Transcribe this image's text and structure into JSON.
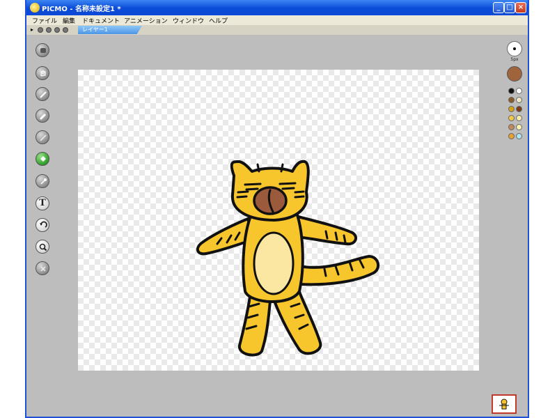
{
  "window": {
    "title": "PICMO - 名称未設定1 *",
    "minimize_label": "_",
    "maximize_label": "□",
    "close_label": "×"
  },
  "menu": {
    "items": [
      "ファイル",
      "編集",
      "ドキュメント",
      "アニメーション",
      "ウィンドウ",
      "ヘルプ"
    ]
  },
  "layers": {
    "active_tab": "レイヤー1"
  },
  "tools": [
    {
      "name": "hand-icon"
    },
    {
      "name": "pan-icon"
    },
    {
      "name": "pencil-icon"
    },
    {
      "name": "brush-icon"
    },
    {
      "name": "eraser-icon"
    },
    {
      "name": "fill-icon"
    },
    {
      "name": "eyedropper-icon"
    },
    {
      "name": "text-icon",
      "label": "T"
    },
    {
      "name": "undo-icon"
    },
    {
      "name": "zoom-icon"
    },
    {
      "name": "clear-icon"
    }
  ],
  "brush": {
    "size_label": "5px"
  },
  "colors": {
    "current": "#a0643c",
    "palette": [
      "#111111",
      "#ffffff",
      "#8b5a2b",
      "#f0e6c8",
      "#d4a017",
      "#7a3e1a",
      "#f2c84b",
      "#f7e7b0",
      "#c08a5a",
      "#fff3b0",
      "#e8a030",
      "#aee4f2"
    ],
    "window_blue": "#0a4ad6",
    "tiger_yellow": "#f7c52c",
    "belly": "#fbe6a2",
    "nose_brown": "#9c5a3c"
  }
}
